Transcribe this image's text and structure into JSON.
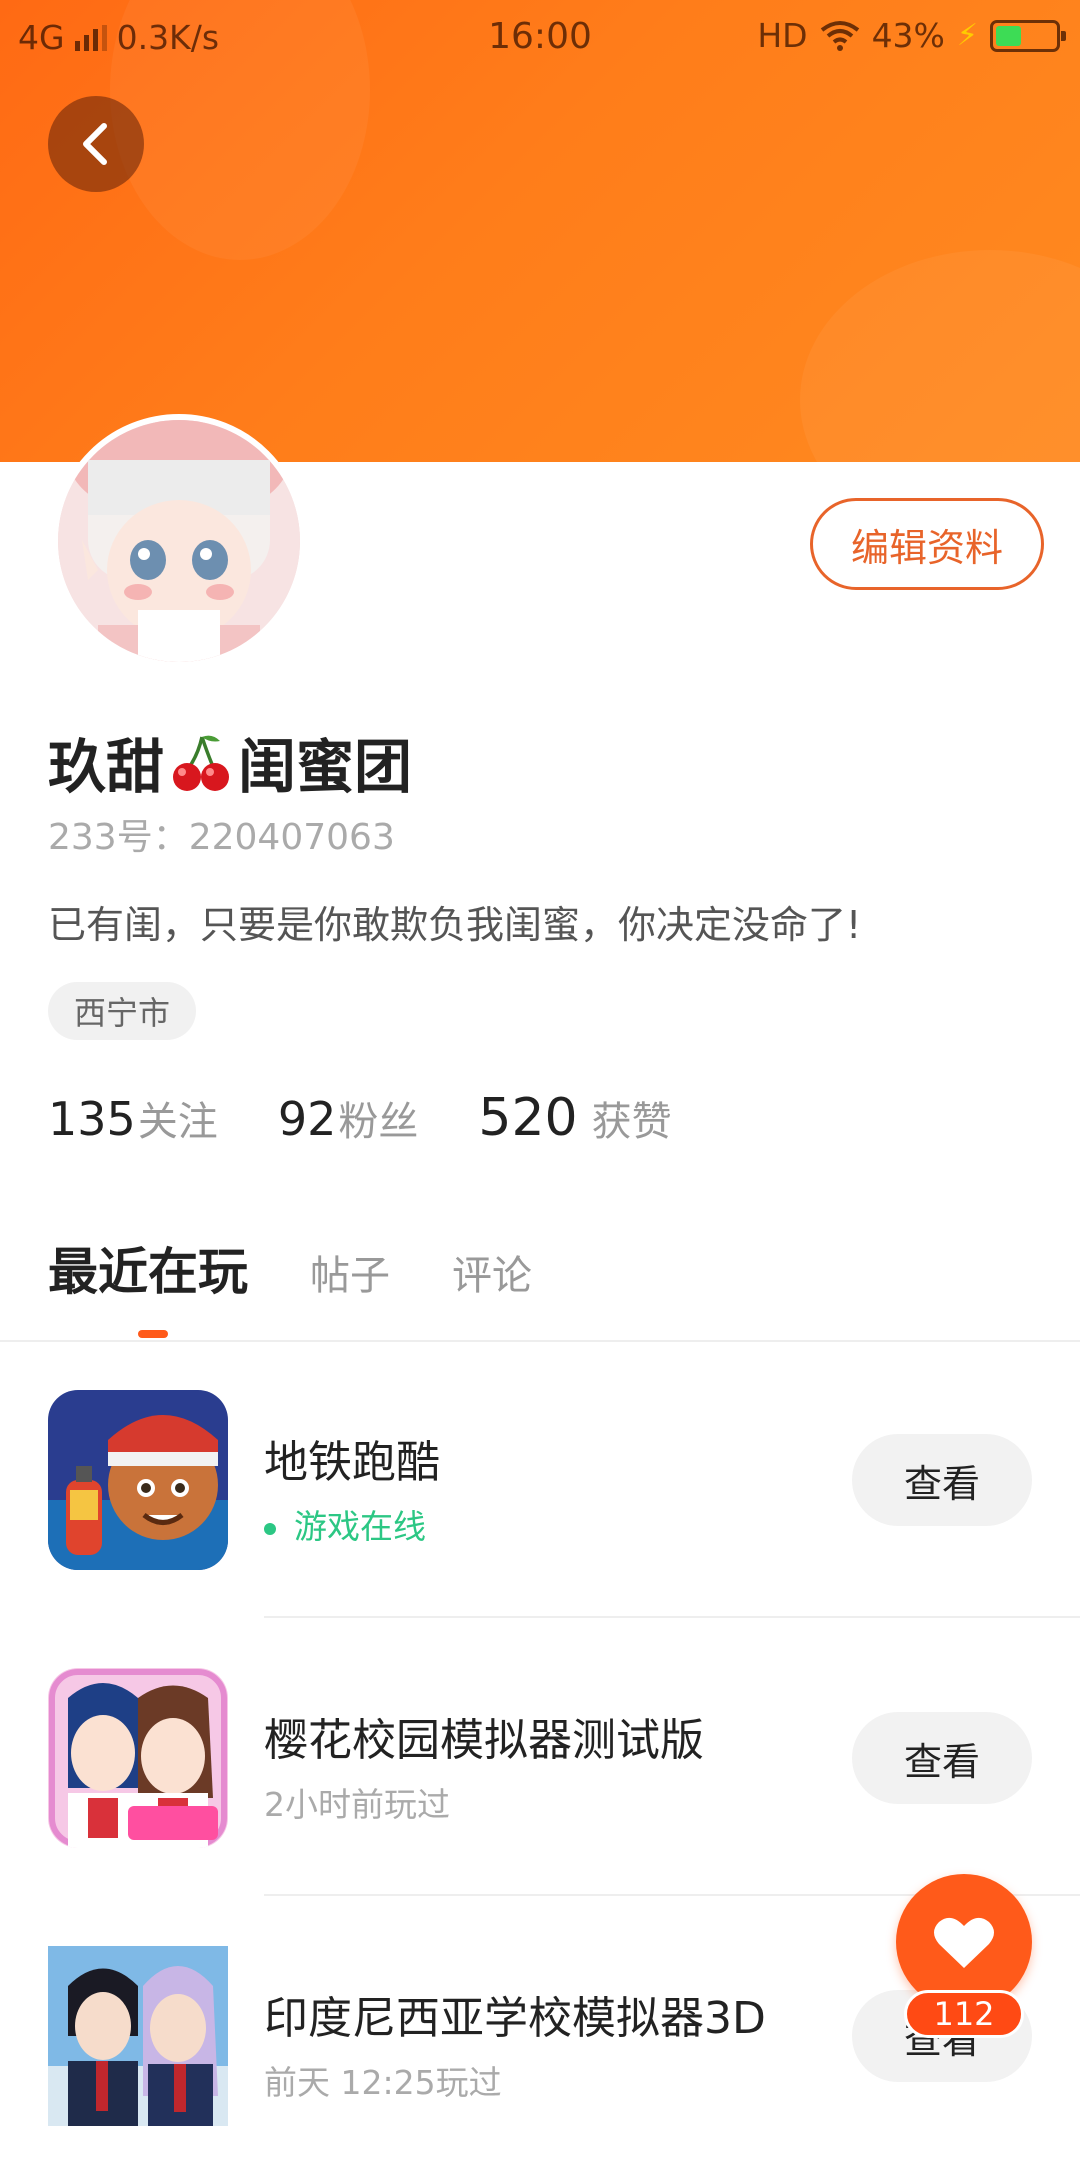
{
  "status_bar": {
    "network": "4G",
    "speed": "0.3K/s",
    "time": "16:00",
    "hd": "HD",
    "battery_percent": "43%",
    "battery_level": 0.43
  },
  "header": {
    "back_icon": "chevron-left-icon",
    "edit_label": "编辑资料",
    "accent_color": "#ff6a14"
  },
  "profile": {
    "name_part1": "玖甜",
    "name_emoji": "cherry-icon",
    "name_part2": "闺蜜团",
    "id_text": "233号：220407063",
    "bio": "已有闺，只要是你敢欺负我闺蜜，你决定没命了!",
    "location": "西宁市"
  },
  "stats": {
    "following_count": "135",
    "following_label": "关注",
    "fans_count": "92",
    "fans_label": "粉丝",
    "likes_count": "520",
    "likes_label": "获赞"
  },
  "tabs": [
    {
      "label": "最近在玩",
      "active": true
    },
    {
      "label": "帖子",
      "active": false
    },
    {
      "label": "评论",
      "active": false
    }
  ],
  "games": [
    {
      "title": "地铁跑酷",
      "subtitle": "游戏在线",
      "online": true,
      "button": "查看"
    },
    {
      "title": "樱花校园模拟器测试版",
      "subtitle": "2小时前玩过",
      "online": false,
      "button": "查看"
    },
    {
      "title": "印度尼西亚学校模拟器3D",
      "subtitle": "前天 12:25玩过",
      "online": false,
      "button": "查看"
    }
  ],
  "fab": {
    "icon": "heart-icon",
    "count": "112"
  }
}
